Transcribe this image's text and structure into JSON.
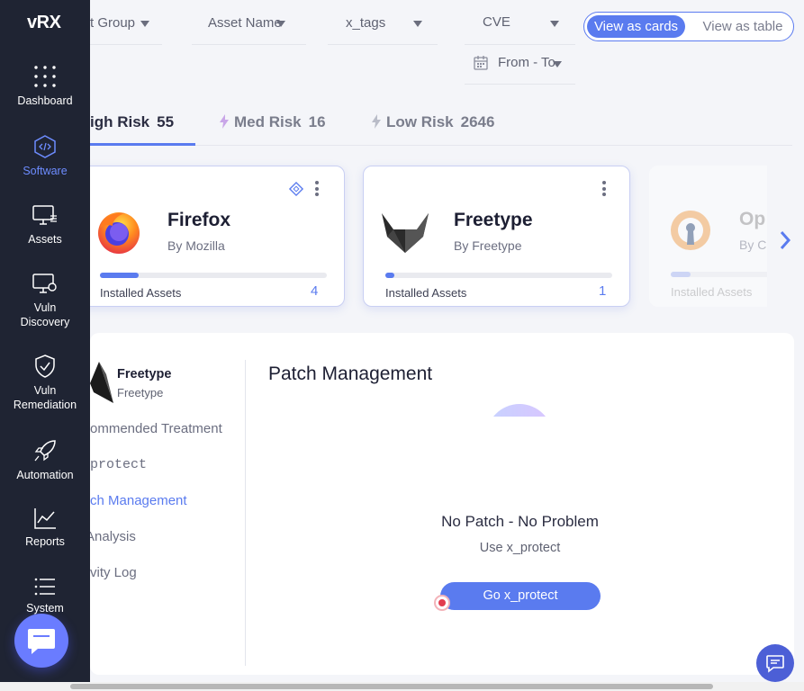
{
  "sidebar": {
    "logo": "vRX",
    "items": [
      {
        "label": "Dashboard",
        "icon": "dots-grid-icon"
      },
      {
        "label": "Software",
        "icon": "code-hexagon-icon"
      },
      {
        "label": "Assets",
        "icon": "monitor-stack-icon"
      },
      {
        "label": "Vuln",
        "label2": "Discovery",
        "icon": "monitor-search-icon"
      },
      {
        "label": "Vuln",
        "label2": "Remediation",
        "icon": "shield-check-icon"
      },
      {
        "label": "Automation",
        "icon": "rocket-icon"
      },
      {
        "label": "Reports",
        "icon": "chart-line-icon"
      },
      {
        "label": "System",
        "icon": "list-icon"
      }
    ]
  },
  "filters": {
    "group": "t Group",
    "asset_name": "Asset Name",
    "tags": "x_tags",
    "cve": "CVE",
    "date": "From - To"
  },
  "view_toggle": {
    "cards": "View as cards",
    "table": "View as table"
  },
  "risk_tabs": [
    {
      "label": "High Risk",
      "shown": "igh Risk",
      "count": "55"
    },
    {
      "label": "Med Risk",
      "count": "16"
    },
    {
      "label": "Low Risk",
      "count": "2646"
    }
  ],
  "cards": [
    {
      "name": "Firefox",
      "vendor": "By Mozilla",
      "installed_label": "Installed Assets",
      "count": "4",
      "progress": 0.17
    },
    {
      "name": "Freetype",
      "vendor": "By Freetype",
      "installed_label": "Installed Assets",
      "count": "1",
      "progress": 0.04
    },
    {
      "name": "Op",
      "vendor": "By C",
      "installed_label": "Installed Assets",
      "progress": 0.2
    }
  ],
  "detail": {
    "app_name": "Freetype",
    "app_vendor": "Freetype",
    "menu": [
      {
        "label": "ommended Treatment"
      },
      {
        "label": "protect"
      },
      {
        "label": "ch Management"
      },
      {
        "label": " Analysis"
      },
      {
        "label": "vity Log"
      }
    ],
    "title": "Patch Management",
    "empty_title": "No Patch - No Problem",
    "empty_sub": "Use x_protect",
    "cta": "Go x_protect"
  },
  "colors": {
    "accent": "#5a7bef",
    "sidebar": "#1f2433",
    "active_nav": "#6d8cff"
  }
}
